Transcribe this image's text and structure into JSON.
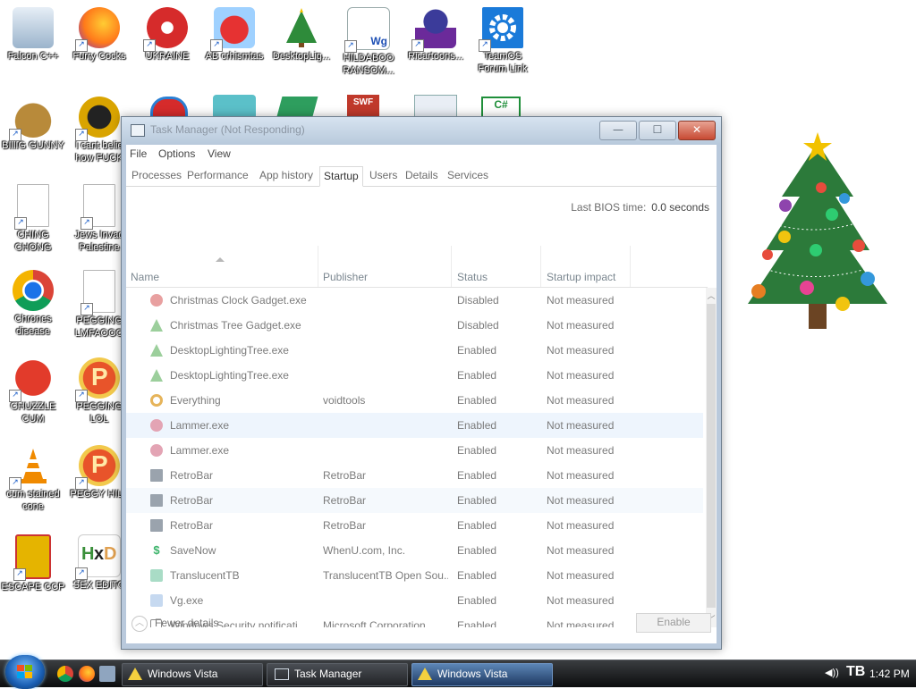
{
  "desktop": {
    "icons": [
      {
        "label": "Falcon C++"
      },
      {
        "label": "Furry Cocks"
      },
      {
        "label": "UKRAINE"
      },
      {
        "label": "AB crhismtas"
      },
      {
        "label": "DesktopLig..."
      },
      {
        "label": "HILDABOO RANSOM..."
      },
      {
        "label": "Ricartoons..."
      },
      {
        "label": "TeamOS Forum Link"
      },
      {
        "label": "BIllIG GUNNY"
      },
      {
        "label": "I cant belie how FUCK"
      },
      {
        "label": "CHING CHONG"
      },
      {
        "label": "Jews Invad Palestine"
      },
      {
        "label": "Chrones disease"
      },
      {
        "label": "PEGGING LMFAOOO"
      },
      {
        "label": "CHUZZLE CUM"
      },
      {
        "label": "PEGGING LOL"
      },
      {
        "label": "cum stained cone"
      },
      {
        "label": "PEGGY HILL"
      },
      {
        "label": "ESCAPE CCP"
      },
      {
        "label": "SEX EDITO"
      }
    ]
  },
  "window": {
    "title": "Task Manager (Not Responding)",
    "menu": [
      "File",
      "Options",
      "View"
    ],
    "tabs": [
      "Processes",
      "Performance",
      "App history",
      "Startup",
      "Users",
      "Details",
      "Services"
    ],
    "bios_label": "Last BIOS time:",
    "bios_value": "0.0 seconds",
    "columns": [
      "Name",
      "Publisher",
      "Status",
      "Startup impact"
    ],
    "rows": [
      {
        "name": "Christmas Clock Gadget.exe",
        "publisher": "",
        "status": "Disabled",
        "impact": "Not measured"
      },
      {
        "name": "Christmas Tree Gadget.exe",
        "publisher": "",
        "status": "Disabled",
        "impact": "Not measured"
      },
      {
        "name": "DesktopLightingTree.exe",
        "publisher": "",
        "status": "Enabled",
        "impact": "Not measured"
      },
      {
        "name": "DesktopLightingTree.exe",
        "publisher": "",
        "status": "Enabled",
        "impact": "Not measured"
      },
      {
        "name": "Everything",
        "publisher": "voidtools",
        "status": "Enabled",
        "impact": "Not measured"
      },
      {
        "name": "Lammer.exe",
        "publisher": "",
        "status": "Enabled",
        "impact": "Not measured"
      },
      {
        "name": "Lammer.exe",
        "publisher": "",
        "status": "Enabled",
        "impact": "Not measured"
      },
      {
        "name": "RetroBar",
        "publisher": "RetroBar",
        "status": "Enabled",
        "impact": "Not measured"
      },
      {
        "name": "RetroBar",
        "publisher": "RetroBar",
        "status": "Enabled",
        "impact": "Not measured"
      },
      {
        "name": "RetroBar",
        "publisher": "RetroBar",
        "status": "Enabled",
        "impact": "Not measured"
      },
      {
        "name": "SaveNow",
        "publisher": "WhenU.com, Inc.",
        "status": "Enabled",
        "impact": "Not measured"
      },
      {
        "name": "TranslucentTB",
        "publisher": "TranslucentTB Open Sou...",
        "status": "Enabled",
        "impact": "Not measured"
      },
      {
        "name": "Vg.exe",
        "publisher": "",
        "status": "Enabled",
        "impact": "Not measured"
      },
      {
        "name": "Windows Security notificati...",
        "publisher": "Microsoft Corporation",
        "status": "Enabled",
        "impact": "Not measured"
      }
    ],
    "fewer_details": "Fewer details",
    "enable_button": "Enable"
  },
  "taskbar": {
    "buttons": [
      {
        "label": "Windows Vista"
      },
      {
        "label": "Task Manager"
      },
      {
        "label": "Windows Vista"
      }
    ],
    "tray_time": "1:42 PM"
  }
}
